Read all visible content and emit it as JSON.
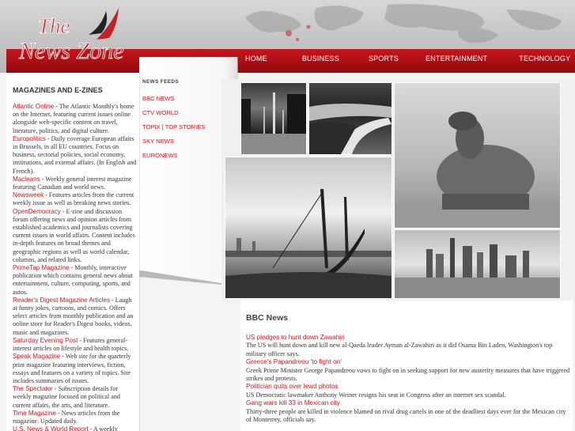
{
  "logo": {
    "line1": "The",
    "line2": "News Zone"
  },
  "nav": [
    {
      "label": "HOME",
      "name": "home"
    },
    {
      "label": "BUSINESS",
      "name": "business"
    },
    {
      "label": "SPORTS",
      "name": "sports"
    },
    {
      "label": "ENTERTAINMENT",
      "name": "entertainment"
    },
    {
      "label": "TECHNOLOGY",
      "name": "technology"
    }
  ],
  "sidebar": {
    "heading": "MAGAZINES AND E-ZINES",
    "items": [
      {
        "name": "Atlantic Online",
        "desc": " - The Atlantic Monthly's home on the Internet, featuring current issues online alongside web-specific content on travel, literature, politics, and digital culture."
      },
      {
        "name": "Europolitics",
        "desc": " - Daily coverage European affairs in Brussels, in all EU countries. Focus on business, sectorial policies, social economy, institutions, and external affairs. (In English and French)."
      },
      {
        "name": "Macleans",
        "desc": " - Weekly general interest magazine featuring Canadian and world news."
      },
      {
        "name": "Newsweek",
        "desc": " - Features articles from the current weekly issue as well as breaking news stories."
      },
      {
        "name": "OpenDemocracy",
        "desc": " - E-zine and discussion forum offering news and opinion articles from established academics and journalists covering current issues in world affairs. Content includes in-depth features on broad themes and geographic regions as well as world calendar, columns, and related links."
      },
      {
        "name": "PrimeTap Magazine",
        "desc": " - Monthly, interactive publication which contains general news about entertainment, culture, computing, sports, and autos."
      },
      {
        "name": "Reader's Digest Magazine Articles",
        "desc": " - Laugh at funny jokes, cartoons, and comics. Offers select articles from monthly publication and an online store for Reader's Digest books, videos, music and magazines."
      },
      {
        "name": "Saturday Evening Post",
        "desc": " - Features general-interest articles on lifestyle and health topics."
      },
      {
        "name": "Speak Magazine",
        "desc": " - Web site for the quarterly print magazine featuring interviews, fiction, essays and features on a variety of topics. Site includes summaries of issues."
      },
      {
        "name": "The Spectator",
        "desc": " - Subscription details for weekly magazine focused on political and current affairs, the arts, and literature."
      },
      {
        "name": "Time Magazine",
        "desc": " - News articles from the magazine. Updated daily."
      },
      {
        "name": "U.S. News & World Report",
        "desc": " - A weekly national newsmagazine devoted"
      }
    ]
  },
  "feeds": {
    "title": "NEWS FEEDS",
    "items": [
      "BBC NEWS",
      "CTV WORLD",
      "TOPIX | TOP STORIES",
      "SKY NEWS",
      "EURONEWS"
    ]
  },
  "photos": [
    "fountain-photo",
    "canal-photo",
    "camel-photo",
    "boat-photo",
    "skyline-photo"
  ],
  "content": {
    "heading": "BBC News",
    "items": [
      {
        "title": "US pledges to hunt down Zawahiri",
        "summary": "The US will hunt down and kill new al-Qaeda leader Ayman al-Zawahiri as it did Osama Bin Laden, Washington's top military officer says."
      },
      {
        "title": "Greece's Papandreou 'to fight on'",
        "summary": "Greek Prime Minister George Papandreou vows to fight on in seeking support for new austerity measures that have triggered strikes and protests."
      },
      {
        "title": "Politician quits over lewd photos",
        "summary": "US Democratic lawmaker Anthony Weiner resigns his seat in Congress after an internet sex scandal."
      },
      {
        "title": "Gang wars kill 33 in Mexican city",
        "summary": "Thirty-three people are killed in violence blamed on rival drug cartels in one of the deadliest days ever for the Mexican city of Monterrey, officials say."
      }
    ]
  },
  "colors": {
    "accent": "#d2161d",
    "navbar": "#b8121a"
  }
}
